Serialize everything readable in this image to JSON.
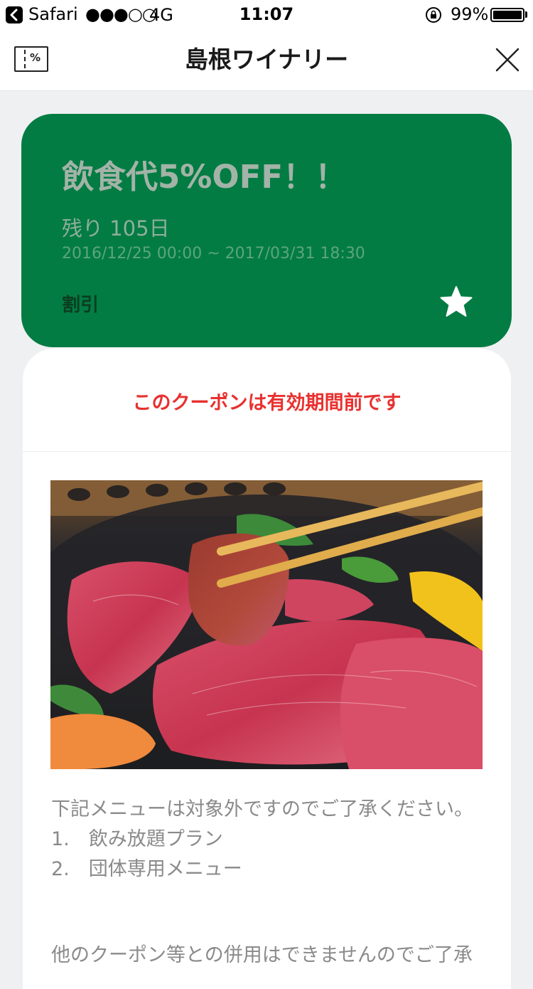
{
  "status_bar": {
    "back_app": "Safari",
    "signal": "●●●○○",
    "network": "4G",
    "time": "11:07",
    "battery": "99%"
  },
  "nav": {
    "title": "島根ワイナリー",
    "coupon_icon_symbol": "%",
    "coupon_icon": "coupon-ticket-icon",
    "close_icon": "close-icon"
  },
  "coupon": {
    "title": "飲食代5%OFF！！",
    "remaining": "残り 105日",
    "period": "2016/12/25 00:00 ~ 2017/03/31 18:30",
    "category": "割引",
    "favorite_icon": "star-icon",
    "card_color": "#027c43"
  },
  "detail": {
    "notice": "このクーポンは有効期間前です",
    "notice_color": "#e8312f",
    "photo_icon": "grilled-beef-photo",
    "description": "下記メニューは対象外ですのでご了承ください。",
    "excluded_items": [
      "1.　飲み放題プラン",
      "2.　団体専用メニュー"
    ],
    "more_text": "他のクーポン等との併用はできませんのでご了承"
  }
}
